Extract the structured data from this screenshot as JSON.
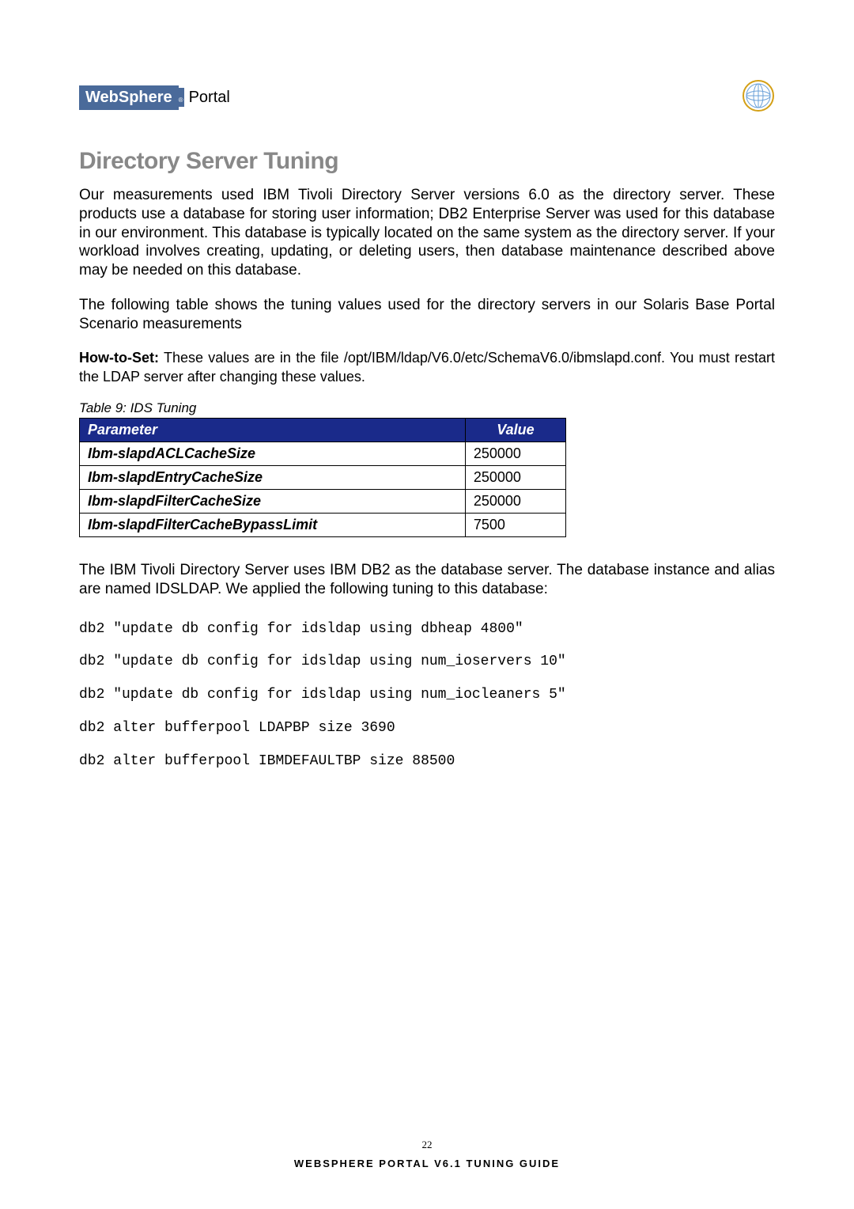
{
  "header": {
    "brand_left": "WebSphere",
    "brand_dot": "®",
    "brand_right": "Portal",
    "globe_alt": "globe-icon"
  },
  "section": {
    "title": "Directory Server Tuning",
    "p1": "Our measurements used IBM Tivoli Directory Server versions 6.0 as the directory server. These products use a database for storing user information; DB2 Enterprise Server was used for this database in our environment. This database is typically located on the same system as the directory server. If your workload involves creating, updating, or deleting users, then database maintenance described above may be needed on this database.",
    "p2": "The following table shows the tuning values used for the directory servers in our  Solaris Base Portal Scenario measurements",
    "howto_label": "How-to-Set:",
    "howto_text": " These values are in the file /opt/IBM/ldap/V6.0/etc/SchemaV6.0/ibmslapd.conf. You must restart the LDAP server after changing these values.",
    "table_caption": "Table 9: IDS Tuning",
    "table_headers": {
      "param": "Parameter",
      "value": "Value"
    },
    "table_rows": [
      {
        "param": "Ibm-slapdACLCacheSize",
        "value": "250000"
      },
      {
        "param": "Ibm-slapdEntryCacheSize",
        "value": "250000"
      },
      {
        "param": "Ibm-slapdFilterCacheSize",
        "value": "250000"
      },
      {
        "param": "Ibm-slapdFilterCacheBypassLimit",
        "value": "7500"
      }
    ],
    "p3": "The IBM Tivoli Directory Server uses IBM DB2 as the database server. The database instance and alias are named IDSLDAP. We applied the following tuning to this database:",
    "commands": [
      "db2 \"update db config for idsldap using dbheap 4800\"",
      "db2 \"update db config for idsldap using num_ioservers 10\"",
      "db2 \"update db config for idsldap using num_iocleaners 5\"",
      "db2 alter bufferpool LDAPBP size 3690",
      "db2 alter bufferpool IBMDEFAULTBP size 88500"
    ]
  },
  "footer": {
    "page": "22",
    "guide": "WEBSPHERE PORTAL V6.1 TUNING GUIDE"
  }
}
